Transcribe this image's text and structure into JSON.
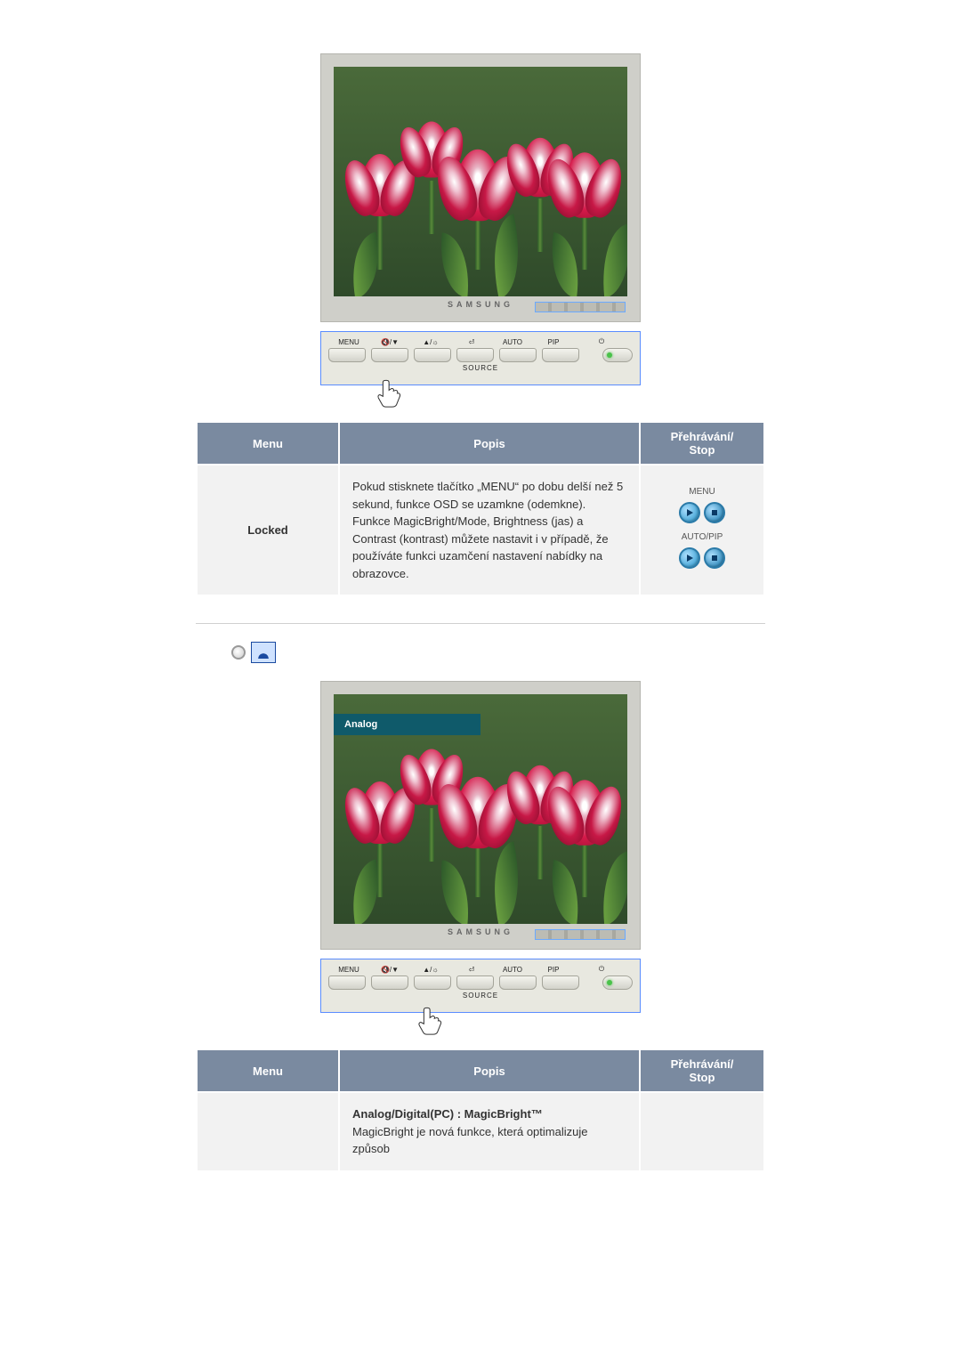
{
  "monitor": {
    "brand": "SAMSUNG",
    "buttons": {
      "menu": "MENU",
      "auto": "AUTO",
      "pip": "PIP",
      "source": "SOURCE",
      "volume_glyph": "🔇/▼",
      "bright_glyph": "▲/☼",
      "enter_glyph": "⏎",
      "power_glyph": "⏻"
    },
    "osd2_label": "Analog"
  },
  "table1": {
    "headers": {
      "menu": "Menu",
      "popis": "Popis",
      "play": "Přehrávání/\nStop"
    },
    "row": {
      "menu": "Locked",
      "popis": "Pokud stisknete tlačítko „MENU“ po dobu delší než 5 sekund, funkce OSD se uzamkne (odemkne). Funkce MagicBright/Mode, Brightness (jas) a Contrast (kontrast) můžete nastavit i v případě, že používáte funkci uzamčení nastavení nabídky na obrazovce.",
      "play_label1": "MENU",
      "play_label2": "AUTO/PIP"
    }
  },
  "table2": {
    "headers": {
      "menu": "Menu",
      "popis": "Popis",
      "play": "Přehrávání/\nStop"
    },
    "row": {
      "popis_title": "Analog/Digital(PC) : MagicBright™",
      "popis_body": "MagicBright je nová funkce, která optimalizuje způsob"
    }
  }
}
